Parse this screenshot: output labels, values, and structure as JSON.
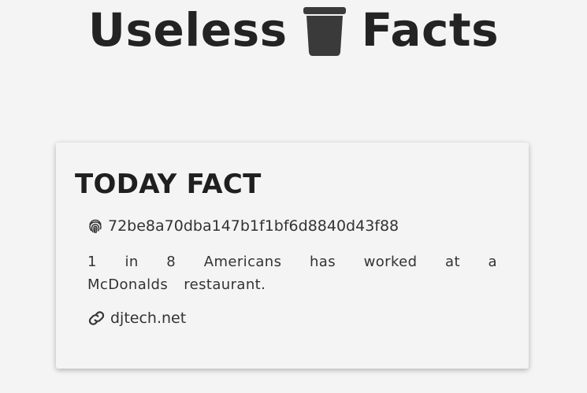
{
  "header": {
    "title_part1": "Useless",
    "title_icon": "trash-icon",
    "title_part2": "Facts"
  },
  "card": {
    "title": "TODAY FACT",
    "fact_id_icon": "fingerprint-icon",
    "fact_id": "72be8a70dba147b1f1bf6d8840d43f88",
    "fact_text": "1 in 8 Americans has worked at a McDonalds restaurant.",
    "source_icon": "link-icon",
    "source": "djtech.net"
  },
  "colors": {
    "background": "#f4f4f4",
    "text_dark": "#232323",
    "text_body": "#333333"
  }
}
